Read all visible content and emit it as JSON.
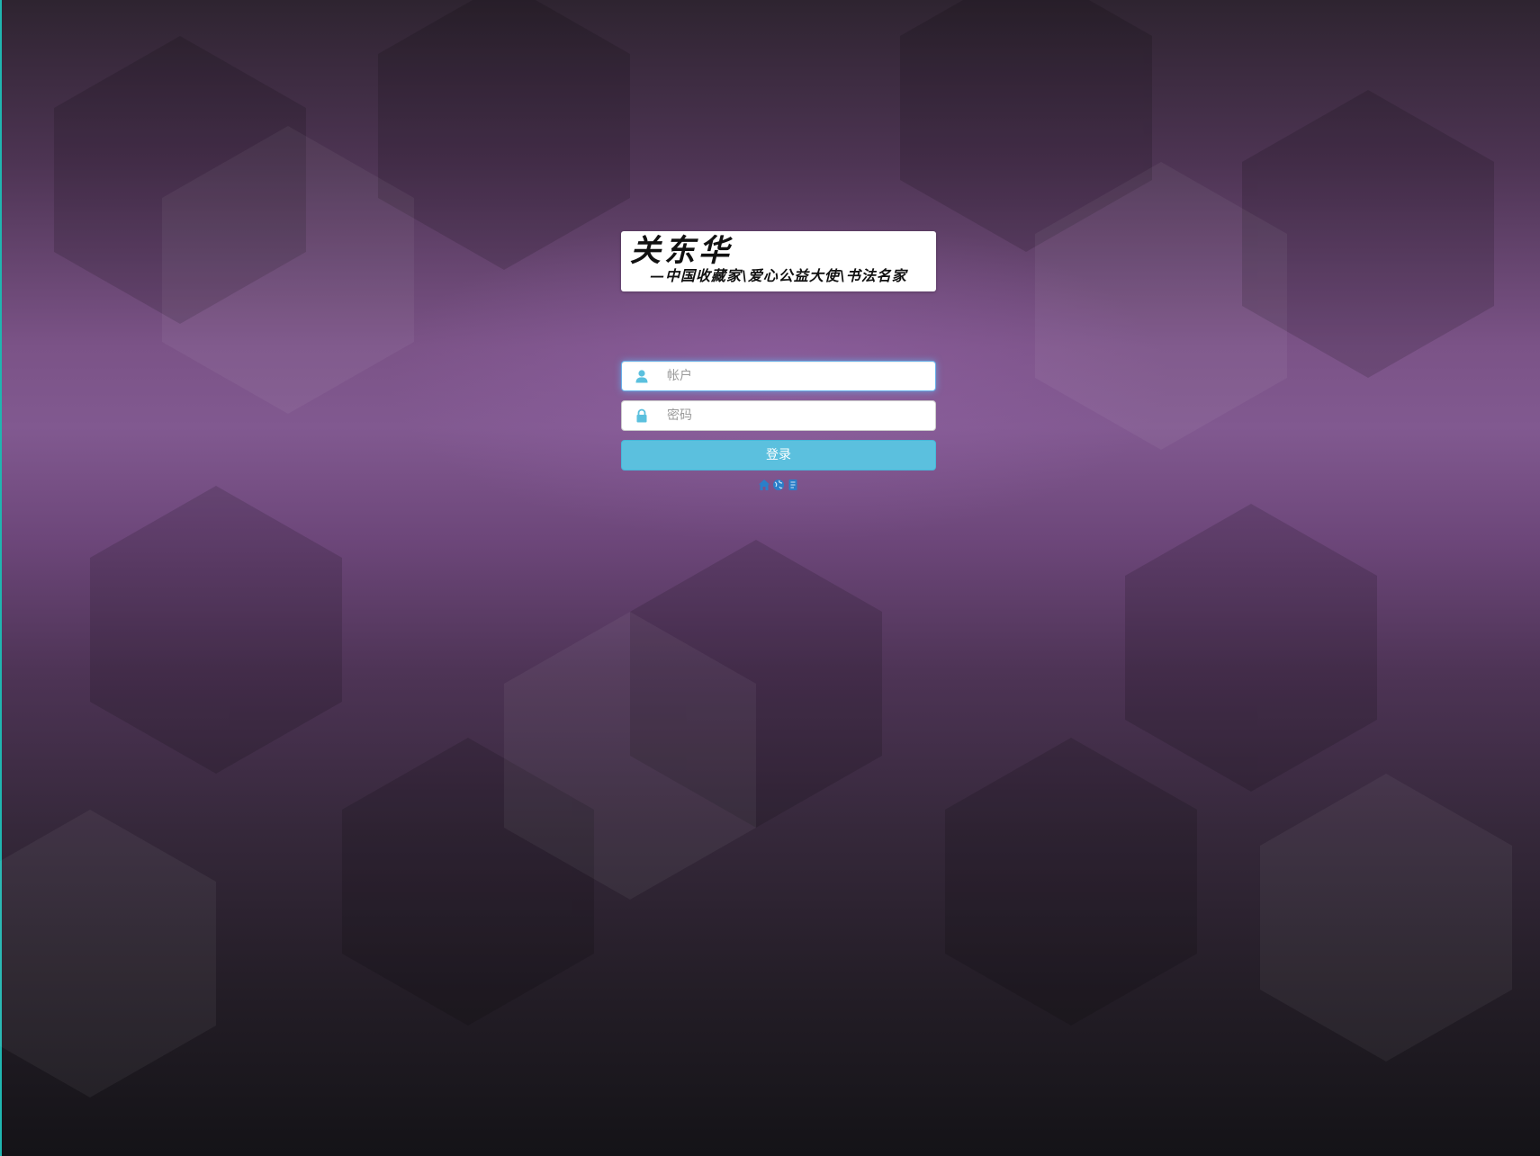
{
  "logo": {
    "name": "关东华",
    "tagline": "—中国收藏家\\爱心公益大使\\书法名家"
  },
  "login_form": {
    "account_placeholder": "帐户",
    "account_value": "",
    "password_placeholder": "密码",
    "password_value": "",
    "login_label": "登录"
  },
  "quick_links": [
    {
      "icon": "home-icon"
    },
    {
      "icon": "globe-icon"
    },
    {
      "icon": "document-icon"
    }
  ],
  "colors": {
    "button": "#5bc0de",
    "icon": "#5bc0de",
    "link_icon": "#2a7fc9",
    "focus_glow": "#66afe9",
    "edge_accent": "#1fb6b0"
  }
}
